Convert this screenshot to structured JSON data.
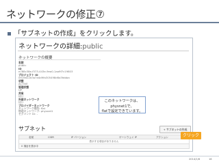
{
  "slide": {
    "title": "ネットワークの修正⑦",
    "bullet": "「サブネットの作成」をクリックします。",
    "click_badge": "クリック",
    "footer": {
      "date": "2014/1/8",
      "page": "16"
    }
  },
  "screenshot": {
    "header_prefix": "ネットワークの詳細:",
    "header_name": "public",
    "overview_title": "ネットワークの概要",
    "details": [
      {
        "label": "名前",
        "value": "public"
      },
      {
        "label": "ID",
        "value": "e788c38e-f373-443e-9ea0-1aa9f7c19803"
      },
      {
        "label": "プロジェクト ID",
        "value": "0919d22d3a7d4d9fa305498d6a3fabba"
      },
      {
        "label": "状態",
        "value": "ACTIVE"
      },
      {
        "label": "管理状態",
        "value": "UP"
      },
      {
        "label": "共有",
        "value": "はい"
      },
      {
        "label": "外部ネットワーク",
        "value": "はい"
      },
      {
        "label": "プロバイダーネットワーク",
        "value": "ネットワーク種別: flat"
      },
      {
        "label": "",
        "value": "物理ネットワーク: physnet1"
      },
      {
        "label": "",
        "value": "セグメント ID: -"
      }
    ],
    "callout_line1": "このネットワークは、physnet1で、",
    "callout_line2": "flatで設定できています。",
    "subnet_title": "サブネット",
    "create_button": "+ サブネットの作成",
    "table_headers": [
      "名前",
      "CIDR",
      "IP バージョン",
      "ゲートウェイ IP",
      "アクション"
    ],
    "table_empty": "表示する項目がありません",
    "table_footer": "0 項目を表示中"
  }
}
